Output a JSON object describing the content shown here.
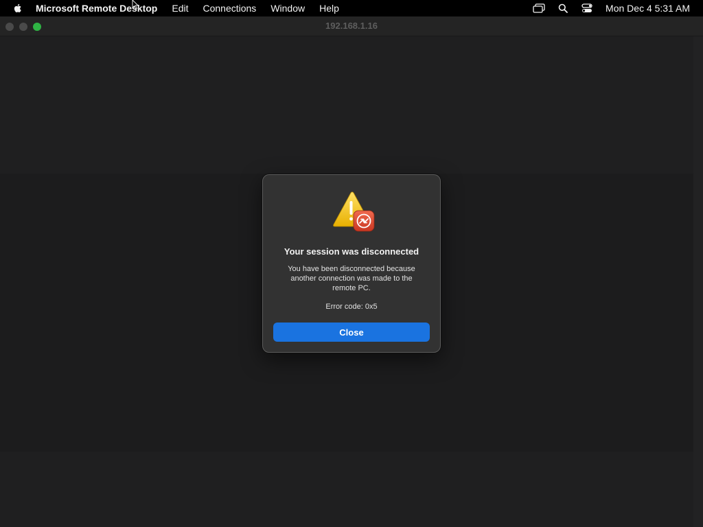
{
  "menubar": {
    "app_name": "Microsoft Remote Desktop",
    "items": [
      {
        "label": "Edit"
      },
      {
        "label": "Connections"
      },
      {
        "label": "Window"
      },
      {
        "label": "Help"
      }
    ],
    "status_icons": [
      "screen-mirroring-icon",
      "search-icon",
      "control-center-icon"
    ],
    "clock": "Mon Dec 4  5:31 AM"
  },
  "window": {
    "title": "192.168.1.16"
  },
  "dialog": {
    "icon": "warning-remote-desktop-icon",
    "title": "Your session was disconnected",
    "message": "You have been disconnected because another connection was made to the remote PC.",
    "error_code": "Error code: 0x5",
    "close_label": "Close"
  },
  "colors": {
    "accent": "#1a73e0",
    "zoom_button": "#2fb344",
    "warning": "#f2c200",
    "rd_badge": "#d9442d"
  }
}
